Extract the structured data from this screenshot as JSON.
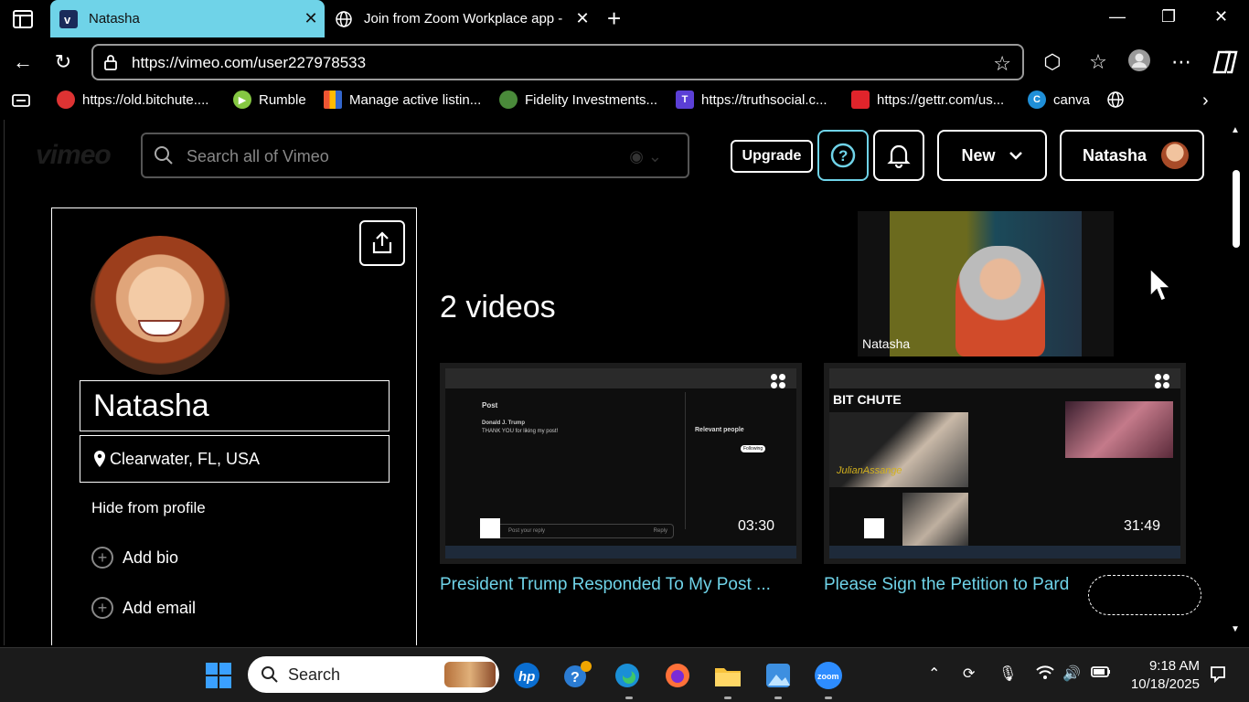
{
  "browser": {
    "tabs": [
      {
        "title": "Natasha",
        "active": true,
        "close": "✕"
      },
      {
        "title": "Join from Zoom Workplace app -",
        "active": false,
        "close": "✕"
      }
    ],
    "new_tab": "+",
    "url": "https://vimeo.com/user227978533"
  },
  "bookmarks": [
    {
      "label": "https://old.bitchute....",
      "color": "#d33"
    },
    {
      "label": "Rumble",
      "color": "#85c742"
    },
    {
      "label": "Manage active listin...",
      "color": "#f4b400"
    },
    {
      "label": "Fidelity Investments...",
      "color": "#4a8a3a"
    },
    {
      "label": "https://truthsocial.c...",
      "color": "#5b3fd6"
    },
    {
      "label": "https://gettr.com/us...",
      "color": "#e0242b"
    },
    {
      "label": "canva",
      "color": "#1f8fd8"
    }
  ],
  "vimeo": {
    "logo": "vimeo",
    "search_placeholder": "Search all of Vimeo",
    "upgrade": "Upgrade",
    "new": "New",
    "user": "Natasha"
  },
  "profile": {
    "name": "Natasha",
    "location": "Clearwater, FL, USA",
    "hide": "Hide from profile",
    "add_bio": "Add bio",
    "add_email": "Add email"
  },
  "videos": {
    "count_label": "2 videos",
    "items": [
      {
        "title": "President Trump Responded To My Post ...",
        "duration": "03:30"
      },
      {
        "title": "Please Sign the Petition to Pard",
        "duration": "31:49"
      }
    ]
  },
  "zoom": {
    "participant": "Natasha"
  },
  "taskbar": {
    "search": "Search",
    "time": "9:18 AM",
    "date": "10/18/2025"
  },
  "thumb1": {
    "post": "Post",
    "author": "Donald J. Trump",
    "text": "THANK YOU for liking my post!",
    "relevant": "Relevant people",
    "following": "Following",
    "reply_ph": "Post your reply",
    "reply": "Reply"
  },
  "thumb2": {
    "brand": "BIT CHUTE",
    "watermark": "JulianAssange"
  }
}
